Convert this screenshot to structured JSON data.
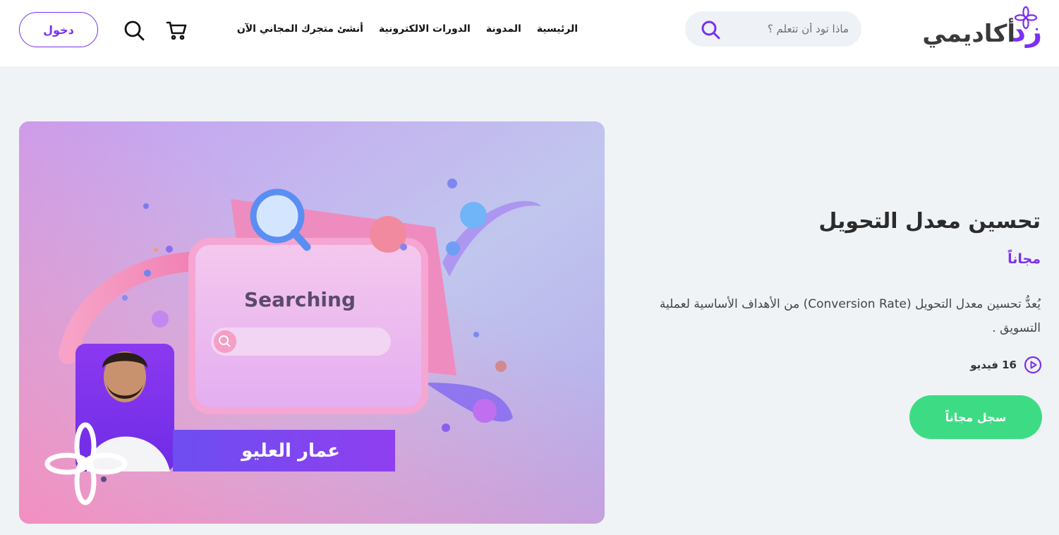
{
  "brand": {
    "logo_text": "أكاديمي",
    "logo_mark": "زد"
  },
  "search": {
    "placeholder": "ماذا تود أن تتعلم ؟"
  },
  "nav": {
    "items": [
      "الرئيسية",
      "المدونة",
      "الدورات الالكترونية",
      "أنشئ متجرك المجاني الآن"
    ]
  },
  "header": {
    "login_label": "دخول"
  },
  "course": {
    "title": "تحسين معدل التحويل",
    "price": "مجاناً",
    "description": "يُعدُّ تحسين معدل التحويل (Conversion Rate) من الأهداف الأساسية لعملية التسويق .",
    "video_count": "16 فيديو",
    "register_label": "سجل مجاناً",
    "image": {
      "searching_text": "Searching",
      "instructor_name": "عمار العليو"
    }
  },
  "colors": {
    "accent": "#7b2ff2",
    "cta": "#3ddc84",
    "page_bg": "#f0f3f6"
  },
  "icons": [
    "flower-logo-icon",
    "search-icon",
    "cart-icon",
    "play-icon"
  ]
}
